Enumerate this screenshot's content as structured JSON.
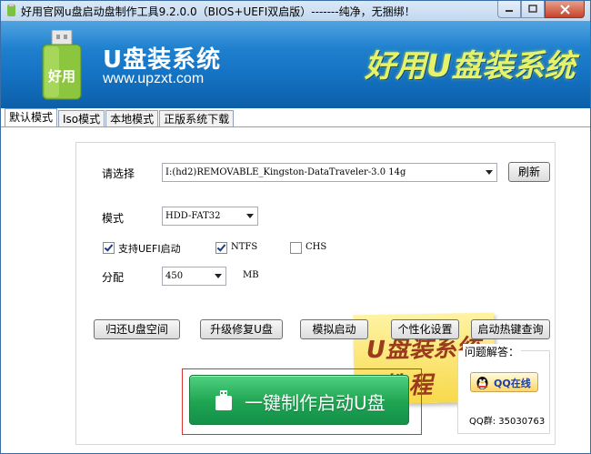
{
  "window": {
    "title": "好用官网u盘启动盘制作工具9.2.0.0（BIOS+UEFI双启版）-------纯净，无捆绑！"
  },
  "banner": {
    "logo_text": "好用",
    "brand_name": "U盘装系统",
    "brand_url": "www.upzxt.com",
    "slogan": "好用U盘装系统"
  },
  "tabs": [
    {
      "label": "默认模式",
      "active": true
    },
    {
      "label": "Iso模式",
      "active": false
    },
    {
      "label": "本地模式",
      "active": false
    },
    {
      "label": "正版系统下载",
      "active": false
    }
  ],
  "form": {
    "select_label": "请选择",
    "device_value": "I:(hd2)REMOVABLE_Kingston-DataTraveler-3.0 14g",
    "refresh_label": "刷新",
    "mode_label": "模式",
    "mode_value": "HDD-FAT32",
    "uefi_label": "支持UEFI启动",
    "uefi_checked": true,
    "ntfs_label": "NTFS",
    "ntfs_checked": true,
    "chs_label": "CHS",
    "chs_checked": false,
    "partition_label": "分配",
    "partition_value": "450",
    "partition_unit": "MB"
  },
  "tutorial_note": {
    "line1": "U盘装系统",
    "line2": "教程"
  },
  "actions": {
    "restore_space": "归还U盘空间",
    "upgrade_repair": "升级修复U盘",
    "simulate_boot": "模拟启动",
    "personalize": "个性化设置",
    "hotkey_query": "启动热键查询"
  },
  "make_button": {
    "label": "一键制作启动U盘"
  },
  "help": {
    "title": "问题解答：",
    "qq_button": "QQ在线",
    "qq_group": "QQ群: 35030763"
  },
  "colors": {
    "banner_blue": "#1573c4",
    "slogan_yellow": "#e6f26a",
    "make_green": "#1fa552",
    "highlight_red": "#dd3333",
    "note_yellow": "#f7d94c"
  }
}
